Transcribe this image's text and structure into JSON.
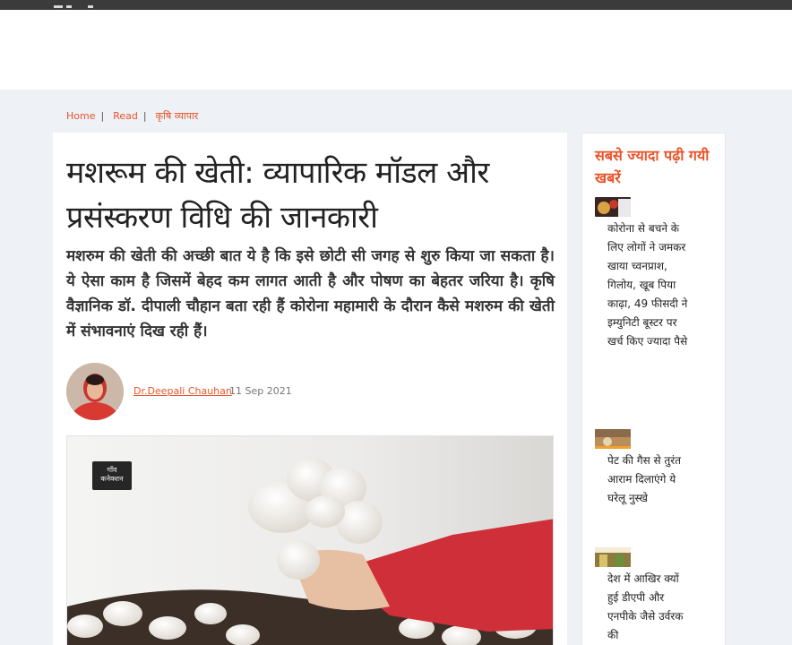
{
  "breadcrumb": {
    "home": "Home",
    "read": "Read",
    "category": "कृषि व्यापार"
  },
  "article": {
    "title": "मशरूम की खेती: व्यापारिक मॉडल और प्रसंस्करण विधि की जानकारी",
    "summary": "मशरुम की खेती की अच्छी बात ये है कि इसे छोटी सी जगह से शुरु किया जा सकता है। ये ऐसा काम है जिसमें बेहद कम लागत आती है और पोषण का बेहतर जरिया है। कृषि वैज्ञानिक डॉ. दीपाली चौहान बता रही हैं कोरोना महामारी के दौरान कैसे मशरुम की खेती में संभावनाएं दिख रही हैं।",
    "author": "Dr.Deepali Chauhan",
    "date": "11 Sep 2021"
  },
  "sidebar": {
    "title": "सबसे ज्यादा पढ़ी गयी खबरें",
    "stories": [
      {
        "title": "कोरोना से बचने के लिए लोगों ने जमकर खाया च्वनप्राश, गिलोय, खूब पिया काढ़ा, 49 फीसदी ने इम्युनिटी बूस्टर पर खर्च किए ज्यादा पैसे"
      },
      {
        "title": "पेट की गैस से तुरंत आराम दिलाएंगे ये घरेलू नुस्खे"
      },
      {
        "title": "देश में आखिर क्यों हुई डीएपी और एनपीके जैसे उर्वरक की"
      }
    ]
  },
  "colors": {
    "accent": "#e8542b",
    "topbar": "#3b3b3b",
    "page_bg": "#eef1f6"
  }
}
